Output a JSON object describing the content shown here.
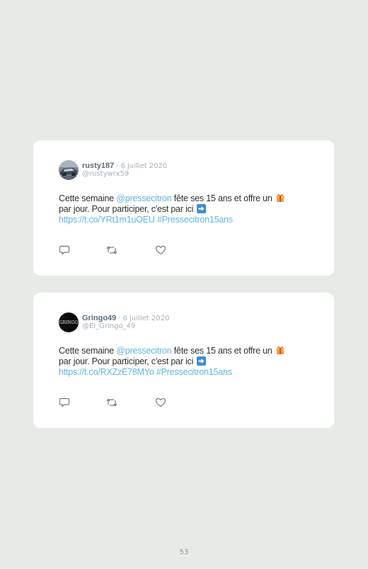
{
  "tweets": [
    {
      "username": "rusty187",
      "separator": "·",
      "date": "6 juillet 2020",
      "handle": "@rustywrx59",
      "text_part1": "Cette semaine ",
      "mention": "@pressecitron",
      "text_part2": " fête ses 15 ans et offre un",
      "text_line2": "par jour. Pour participer, c'est par ici",
      "link": "https://t.co/YRt1m1uOEU",
      "hashtag": "#Pressecitron15ans",
      "avatar_icon": "car-photo-avatar",
      "actions": [
        "reply-icon",
        "retweet-icon",
        "like-icon"
      ]
    },
    {
      "username": "Gringo49",
      "separator": "·",
      "date": "6 juillet 2020",
      "handle": "@El_Gringo_49",
      "text_part1": "Cette semaine ",
      "mention": "@pressecitron",
      "text_part2": " fête ses 15 ans et offre un",
      "text_line2": "par jour. Pour participer, c'est par ici",
      "link": "https://t.co/RXZzE78MYo",
      "hashtag": "#Pressecitron15ans",
      "avatar_icon": "black-logo-avatar",
      "avatar_text": "GRINGO",
      "actions": [
        "reply-icon",
        "retweet-icon",
        "like-icon"
      ]
    }
  ],
  "page_number": "53",
  "colors": {
    "background": "#e6ebe5",
    "card": "#ffffff",
    "link": "#5fb5e0",
    "username": "#5b6d7c",
    "meta": "#a4b0ba"
  }
}
